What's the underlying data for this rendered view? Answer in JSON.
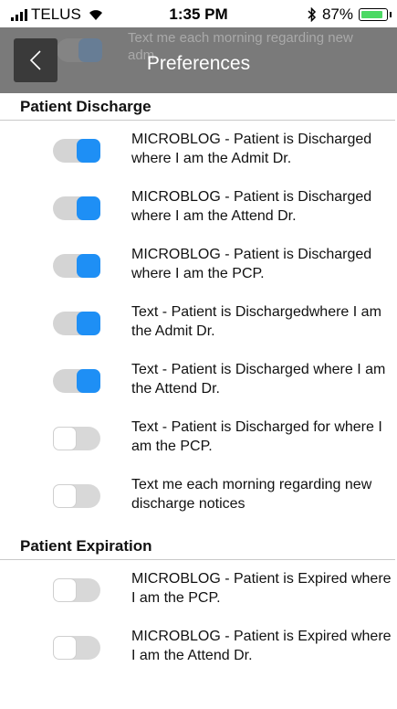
{
  "status_bar": {
    "carrier": "TELUS",
    "time": "1:35 PM",
    "battery": "87%",
    "battery_level": 0.87
  },
  "header": {
    "title": "Preferences",
    "ghost_text_line1": "Text me each morning regarding new",
    "ghost_text_line2": "adm"
  },
  "sections": [
    {
      "title": "Patient Discharge",
      "items": [
        {
          "label": "MICROBLOG - Patient is Discharged where I am the Admit Dr.",
          "on": true
        },
        {
          "label": "MICROBLOG - Patient is Discharged where I am the Attend Dr.",
          "on": true
        },
        {
          "label": "MICROBLOG - Patient is Discharged where I am the PCP.",
          "on": true
        },
        {
          "label": "Text - Patient is Dischargedwhere I am the Admit Dr.",
          "on": true
        },
        {
          "label": "Text - Patient is Discharged where I am the Attend Dr.",
          "on": true
        },
        {
          "label": "Text - Patient is Discharged for where I am the PCP.",
          "on": false
        },
        {
          "label": "Text me each morning regarding new discharge notices",
          "on": false
        }
      ]
    },
    {
      "title": "Patient Expiration",
      "items": [
        {
          "label": "MICROBLOG - Patient is Expired where I am the PCP.",
          "on": false
        },
        {
          "label": "MICROBLOG - Patient is Expired where I am the Attend Dr.",
          "on": false
        }
      ]
    }
  ]
}
